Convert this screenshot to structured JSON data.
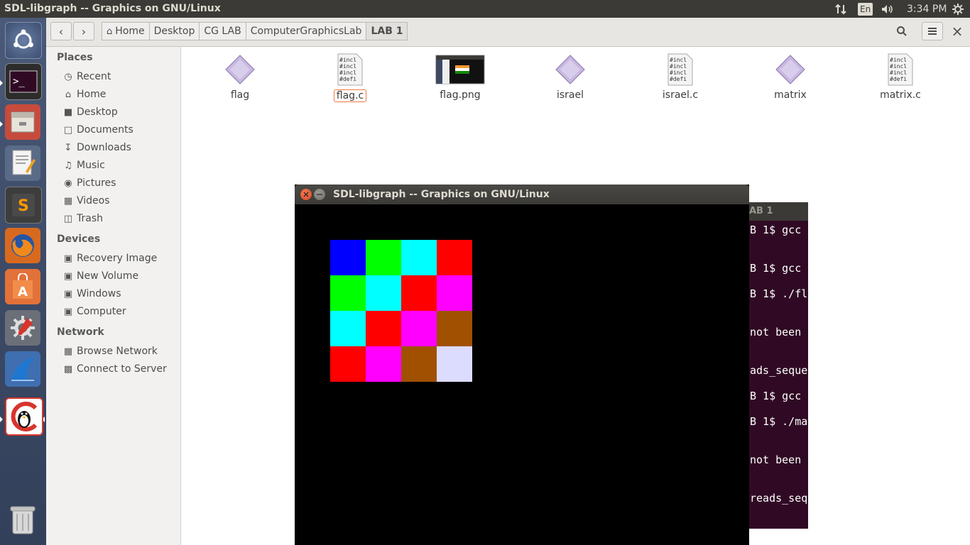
{
  "top_panel": {
    "title": "SDL-libgraph -- Graphics on GNU/Linux",
    "keyboard": "En",
    "clock": "3:34 PM"
  },
  "launcher": {
    "items": [
      "ubuntu-dash",
      "terminal",
      "files",
      "text-editor",
      "sublime-text",
      "firefox",
      "software-center",
      "system-settings",
      "wireshark",
      "sdl-libgraph"
    ],
    "trash": "trash"
  },
  "files": {
    "path": [
      "Home",
      "Desktop",
      "CG LAB",
      "ComputerGraphicsLab",
      "LAB 1"
    ],
    "sidebar": {
      "places_label": "Places",
      "places": [
        "Recent",
        "Home",
        "Desktop",
        "Documents",
        "Downloads",
        "Music",
        "Pictures",
        "Videos",
        "Trash"
      ],
      "devices_label": "Devices",
      "devices": [
        "Recovery Image",
        "New Volume",
        "Windows",
        "Computer"
      ],
      "network_label": "Network",
      "network": [
        "Browse Network",
        "Connect to Server"
      ]
    },
    "items": [
      {
        "name": "flag",
        "type": "executable"
      },
      {
        "name": "flag.c",
        "type": "c-source",
        "selected": true
      },
      {
        "name": "flag.png",
        "type": "image"
      },
      {
        "name": "israel",
        "type": "executable"
      },
      {
        "name": "israel.c",
        "type": "c-source"
      },
      {
        "name": "matrix",
        "type": "executable"
      },
      {
        "name": "matrix.c",
        "type": "c-source"
      }
    ],
    "source_preview": [
      "#incl",
      "#incl",
      "#incl",
      "#defi"
    ]
  },
  "terminal": {
    "title_fragment": "AB 1",
    "lines": [
      "B 1$ gcc",
      "B 1$ gcc",
      "B 1$ ./fl",
      "not been",
      "ads_seque",
      "B 1$ gcc",
      "B 1$ ./ma",
      "not been",
      "reads_seq"
    ]
  },
  "sdl_window": {
    "title": "SDL-libgraph -- Graphics on GNU/Linux",
    "grid_colors": [
      [
        "#0000ff",
        "#00ff00",
        "#00ffff",
        "#ff0000"
      ],
      [
        "#00ff00",
        "#00ffff",
        "#ff0000",
        "#ff00ff"
      ],
      [
        "#00ffff",
        "#ff0000",
        "#ff00ff",
        "#a05000"
      ],
      [
        "#ff0000",
        "#ff00ff",
        "#a05000",
        "#dcdcff"
      ]
    ]
  }
}
